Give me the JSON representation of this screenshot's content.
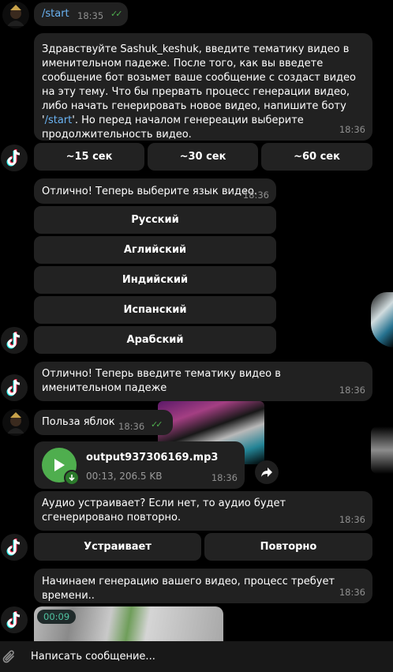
{
  "messages": {
    "start_cmd": {
      "text": "/start",
      "time": "18:35"
    },
    "welcome": {
      "parts": {
        "before": "Здравствуйте Sashuk_keshuk, введите тематику видео в именительном падеже. После того, как вы введете сообщение бот возьмет ваше сообщение с создаст видео на эту тему. Что бы прервать процесс генерации видео, либо начать генерировать новое видео, напишите боту '",
        "link": "/start",
        "after": "'. Но перед началом генереации выберите продолжительность видео."
      },
      "time": "18:36"
    },
    "choose_language": {
      "text": "Отлично! Теперь выберите язык видео.",
      "time": "18:36"
    },
    "enter_topic": {
      "text": "Отлично! Теперь введите тематику видео в именительном падеже",
      "time": "18:36"
    },
    "user_topic": {
      "text": "Польза яблок",
      "time": "18:36"
    },
    "audio_file": {
      "name": "output937306169.mp3",
      "meta": "00:13, 206.5 KB",
      "time": "18:36"
    },
    "audio_question": {
      "text": "Аудио устраивает? Если нет, то аудио будет сгенерировано повторно.",
      "time": "18:36"
    },
    "generation_start": {
      "text": "Начинаем генерацию вашего видео, процесс требует времени..",
      "time": "18:36"
    },
    "video": {
      "duration": "00:09"
    }
  },
  "keyboards": {
    "duration": [
      "~15 сек",
      "~30 сек",
      "~60 сек"
    ],
    "language": [
      "Русский",
      "Аглийский",
      "Индийский",
      "Испанский",
      "Арабский"
    ],
    "audio": [
      "Устраивает",
      "Повторно"
    ]
  },
  "composer": {
    "placeholder": "Написать сообщение..."
  },
  "colors": {
    "background": "#000000",
    "bubble": "#212121",
    "button": "#222222",
    "link": "#6ab3f3",
    "read_checks": "#4fae4e",
    "play_button": "#4fae4e",
    "timestamp": "#8f8f8f"
  },
  "icons": [
    "user-avatar-icon",
    "tiktok-bot-avatar-icon",
    "double-check-icon",
    "play-icon",
    "download-icon",
    "forward-icon",
    "attach-paperclip-icon"
  ]
}
